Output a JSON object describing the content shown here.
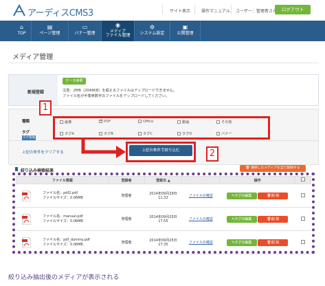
{
  "header": {
    "logo": "アーディスCMS3",
    "site_link": "サイト表示",
    "manual_link": "操作マニュアル",
    "user_label": "ユーザー：管理者さん",
    "logout": "ログアウト"
  },
  "nav": [
    {
      "label": "TOP",
      "icon": "home-icon",
      "glyph": "⌂"
    },
    {
      "label": "ページ管理",
      "icon": "pages-icon",
      "glyph": "▤"
    },
    {
      "label": "バナー管理",
      "icon": "banner-icon",
      "glyph": "▭"
    },
    {
      "label": "メディア\nファイル管理",
      "icon": "camera-icon",
      "glyph": "◉"
    },
    {
      "label": "システム設定",
      "icon": "gears-icon",
      "glyph": "⚙"
    },
    {
      "label": "公開管理",
      "icon": "monitor-icon",
      "glyph": "▣"
    }
  ],
  "page": {
    "title": "メディア管理"
  },
  "upload": {
    "title": "新規登録",
    "button": "データ参照",
    "note1": "注意：2MB（2048KB）を超えるファイルはアップロードできません。",
    "note2": "ファイル名が半角英数字のファイルをアップロードしてください。"
  },
  "filter": {
    "type_label": "種類",
    "tag_label": "タグ",
    "tag_button": "タグ管理",
    "types": [
      "画像",
      "PDF",
      "Office",
      "動画",
      "その他"
    ],
    "type_checked": [
      false,
      true,
      false,
      false,
      false
    ],
    "tags": [
      "タグA",
      "タグB",
      "タグC",
      "タグD",
      "バナー"
    ],
    "clear_link": "上記の条件をクリアする",
    "search_button": "上記の条件で絞り込む"
  },
  "annotations": {
    "n1": "1",
    "n2": "2",
    "caption": "絞り込み抽出後のメディアが表示される"
  },
  "results": {
    "heading": "絞り込み検索結果",
    "delete_all": "選択したメディアを全て削除する",
    "columns": [
      "ファイル情報",
      "登録者",
      "登録日",
      "",
      "操作",
      ""
    ],
    "sort_arrow": "▲",
    "name_label": "ファイル名：",
    "size_label": "ファイルサイズ：",
    "confirm_label": "ファイルの確認",
    "tag_edit": "タグの編集",
    "delete": "削 除",
    "rows": [
      {
        "name": "pdf2.pdf",
        "size": "0.06MB",
        "user": "管理者",
        "date": "2014年09月29日",
        "time": "11:32"
      },
      {
        "name": "manual.pdf",
        "size": "0.06MB",
        "user": "管理者",
        "date": "2014年09月25日",
        "time": "17:55"
      },
      {
        "name": "pdf_dummy.pdf",
        "size": "0.06MB",
        "user": "管理者",
        "date": "2014年09月25日",
        "time": "17:35"
      }
    ]
  },
  "colors": {
    "nav": "#2a5d8c",
    "green": "#74b63b",
    "orange": "#ea4d2a",
    "red": "#e02020",
    "purple": "#6b3b8f"
  }
}
